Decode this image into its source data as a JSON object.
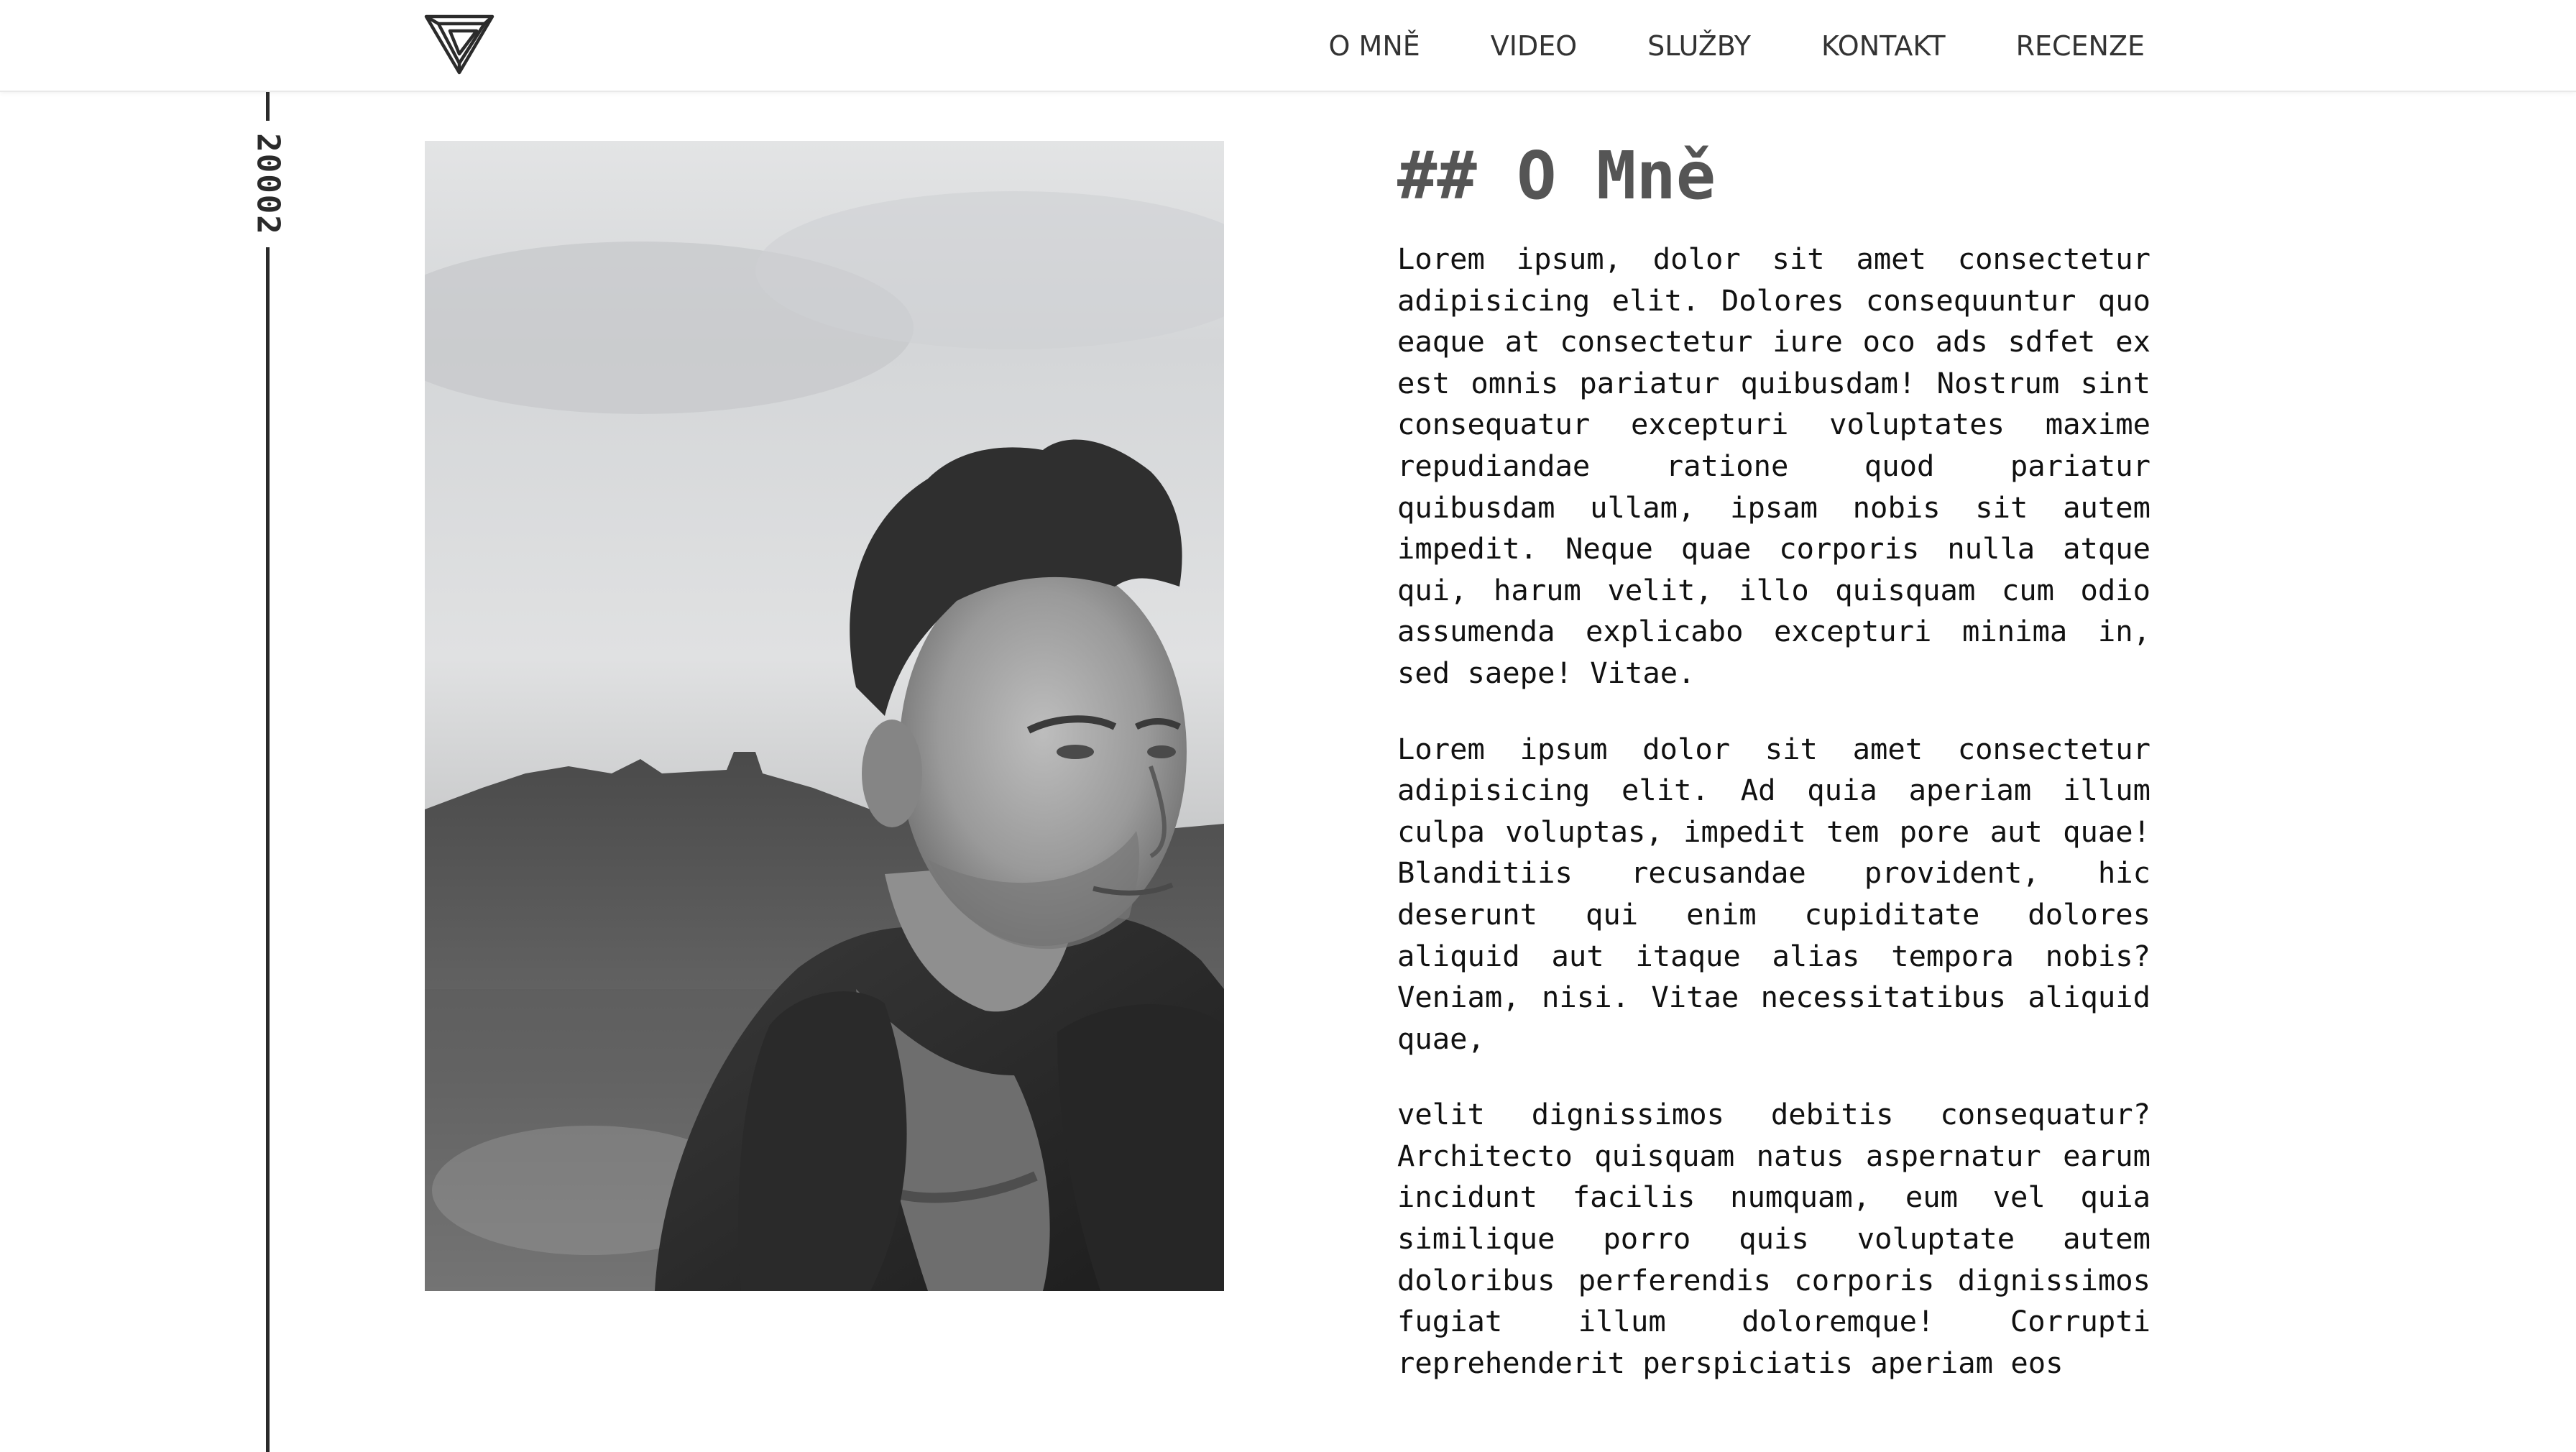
{
  "header": {
    "logo_icon": "inverted-triangle-logo-icon",
    "nav": [
      {
        "label": "O MNĚ"
      },
      {
        "label": "VIDEO"
      },
      {
        "label": "SLUŽBY"
      },
      {
        "label": "KONTAKT"
      },
      {
        "label": "RECENZE"
      }
    ]
  },
  "timeline": {
    "label": "20002"
  },
  "photo": {
    "subject": "portrait-photo"
  },
  "about": {
    "heading": "## O Mně",
    "paragraphs": [
      "Lorem ipsum, dolor sit amet consectetur adipisicing elit. Dolores consequuntur quo eaque at consectetur iure oco ads sdfet ex est omnis pariatur quibusdam! Nostrum sint consequatur excepturi voluptates maxime repudiandae ratione quod pariatur quibusdam ullam, ipsam nobis sit autem impedit. Neque quae corporis nulla atque qui, harum velit, illo quisquam cum odio assumenda explicabo excepturi minima in, sed saepe! Vitae.",
      "Lorem ipsum dolor sit amet consectetur adipisicing elit. Ad quia aperiam illum culpa voluptas, impedit tem pore aut quae! Blanditiis recusandae provident, hic deserunt qui enim cupiditate dolores aliquid aut itaque alias tempora nobis? Veniam, nisi. Vitae necessitatibus aliquid quae,",
      "velit dignissimos debitis consequatur? Architecto quisquam natus aspernatur earum incidunt facilis numquam, eum vel quia similique porro quis voluptate autem doloribus perferendis corporis dignissimos fugiat illum doloremque! Corrupti reprehenderit perspiciatis aperiam eos"
    ]
  },
  "colors": {
    "background": "#ffffff",
    "text": "#111111",
    "heading": "#555555",
    "nav_text": "#333333",
    "timeline": "#2a2a2a"
  }
}
